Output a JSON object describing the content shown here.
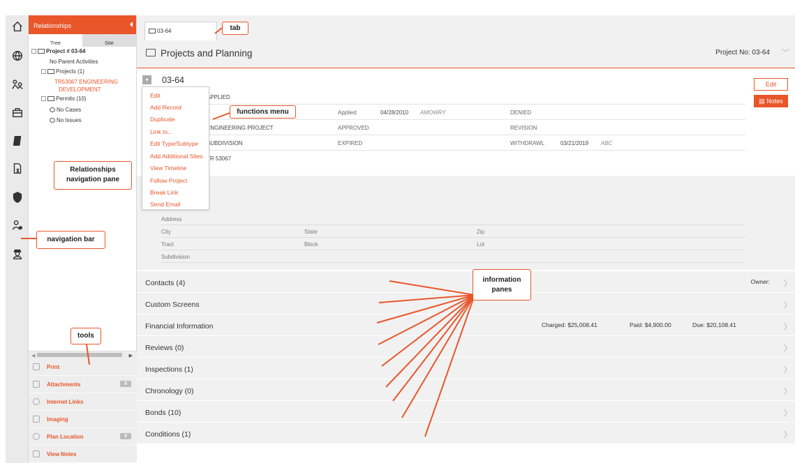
{
  "rel_pane": {
    "header": "Relationships",
    "tabs": [
      "Tree",
      "Site"
    ],
    "tree": {
      "project": "Project # 03-64",
      "parent": "No Parent Activities",
      "projects": "Projects (1)",
      "child1": "TR53067 ENGINEERING",
      "child2": "DEVELOPMENT",
      "permits": "Permits (10)",
      "cases": "No Cases",
      "issues": "No Issues"
    }
  },
  "tools": [
    {
      "label": "Print",
      "badge": ""
    },
    {
      "label": "Attachments",
      "badge": "0"
    },
    {
      "label": "Internet Links",
      "badge": ""
    },
    {
      "label": "Imaging",
      "badge": ""
    },
    {
      "label": "Plan Location",
      "badge": "0"
    },
    {
      "label": "View Notes",
      "badge": ""
    }
  ],
  "main": {
    "tab": "03-64",
    "title": "Projects and Planning",
    "project_no": "Project No: 03-64",
    "record": {
      "number": "03-64",
      "edit": "Edit",
      "notes": "Notes",
      "status": "APPLIED",
      "type": "ENGINEERING PROJECT",
      "subtype": "SUBDIVISION",
      "desc": "TR 53067",
      "applied_label": "Applied",
      "applied_date": "04/28/2010",
      "applied_by": "AMOWRY",
      "approved_label": "APPROVED",
      "expired_label": "EXPIRED",
      "denied_label": "DENIED",
      "revision_label": "REVISION",
      "withdrawl_label": "WITHDRAWL",
      "withdrawl_date": "03/21/2019",
      "withdrawl_by": "ABC"
    },
    "address": {
      "address": "Address",
      "city": "City",
      "state": "State",
      "zip": "Zip",
      "tract": "Tract",
      "block": "Block",
      "lot": "Lot",
      "subdivision": "Subdivision"
    },
    "panes": [
      {
        "label": "Contacts (4)"
      },
      {
        "label": "Custom Screens"
      },
      {
        "label": "Financial Information"
      },
      {
        "label": "Reviews (0)"
      },
      {
        "label": "Inspections (1)"
      },
      {
        "label": "Chronology (0)"
      },
      {
        "label": "Bonds (10)"
      },
      {
        "label": "Conditions (1)"
      }
    ],
    "owner": "Owner:",
    "financial": {
      "charged": "Charged: $25,008.41",
      "paid": "Paid: $4,900.00",
      "due": "Due: $20,108.41"
    }
  },
  "menu": [
    "Edit",
    "Add Record",
    "Duplicate",
    "Link to...",
    "Edit Type/Subtype",
    "Add Additional Sites",
    "View Timeline",
    "Follow Project",
    "Break Link",
    "Send Email"
  ],
  "callouts": {
    "tab": "tab",
    "functions": "functions menu",
    "relationships": "Relationships navigation pane",
    "navigation": "navigation bar",
    "tools": "tools",
    "info": "information panes"
  },
  "colors": {
    "accent": "#e8562a",
    "panel": "#f1f1f1"
  },
  "icons": [
    "home-icon",
    "globe-icon",
    "people-map-icon",
    "briefcase-icon",
    "permit-icon",
    "document-icon",
    "shield-icon",
    "user-key-icon",
    "inspector-icon"
  ]
}
